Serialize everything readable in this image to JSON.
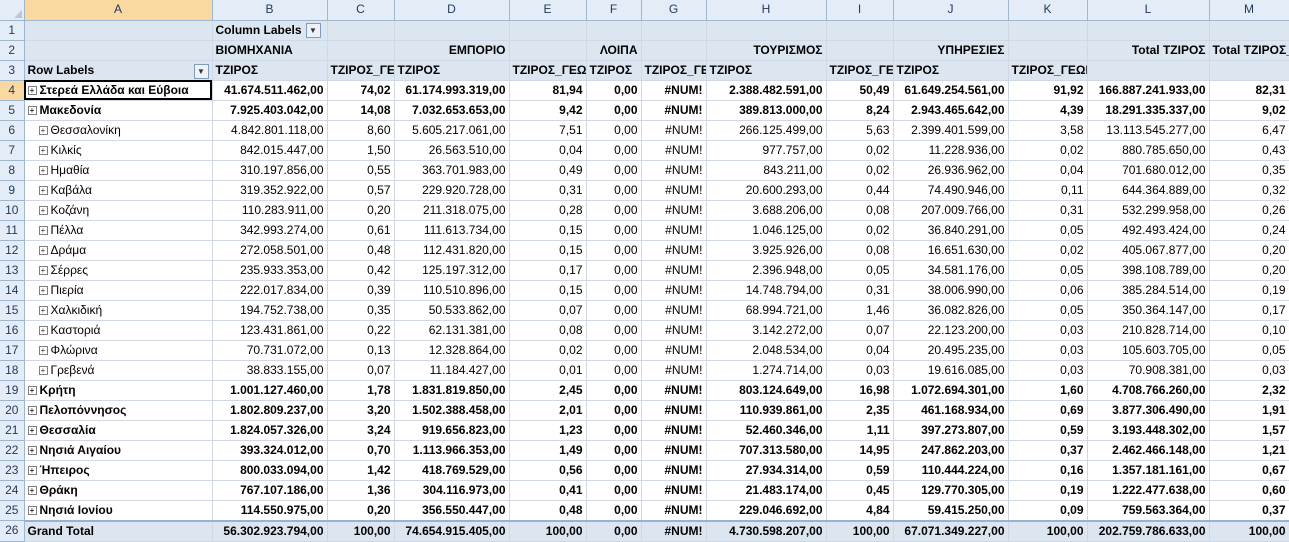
{
  "columns": [
    "A",
    "B",
    "C",
    "D",
    "E",
    "F",
    "G",
    "H",
    "I",
    "J",
    "K",
    "L",
    "M"
  ],
  "rows_numbers": [
    "1",
    "2",
    "3",
    "4",
    "5",
    "6",
    "7",
    "8",
    "9",
    "10",
    "11",
    "12",
    "13",
    "14",
    "15",
    "16",
    "17",
    "18",
    "19",
    "20",
    "21",
    "22",
    "23",
    "24",
    "25",
    "26"
  ],
  "pivot": {
    "column_labels": "Column Labels",
    "row_labels": "Row Labels",
    "categories": {
      "industry": "ΒΙΟΜΗΧΑΝΙΑ",
      "commerce": "ΕΜΠΟΡΙΟ",
      "other": "ΛΟΙΠΑ",
      "tourism": "ΤΟΥΡΙΣΜΟΣ",
      "services": "ΥΠΗΡΕΣΙΕΣ",
      "total_tziros": "Total ΤΖΙΡΟΣ",
      "total_tziros_geo": "Total ΤΖΙΡΟΣ_"
    },
    "subheaders": {
      "b": "ΤΖΙΡΟΣ",
      "c": "ΤΖΙΡΟΣ_ΓΕ",
      "d": "ΤΖΙΡΟΣ",
      "e": "ΤΖΙΡΟΣ_ΓΕΩ",
      "f": "ΤΖΙΡΟΣ",
      "g": "ΤΖΙΡΟΣ_ΓΕΩ",
      "h": "ΤΖΙΡΟΣ",
      "i": "ΤΖΙΡΟΣ_ΓΕ",
      "j": "ΤΖΙΡΟΣ",
      "k": "ΤΖΙΡΟΣ_ΓΕΩΓΡΑΦΙΑ",
      "l": "",
      "m": ""
    },
    "data_rows": [
      {
        "label": "Στερεά Ελλάδα και Εύβοια",
        "level": 0,
        "cells": [
          "41.674.511.462,00",
          "74,02",
          "61.174.993.319,00",
          "81,94",
          "0,00",
          "#NUM!",
          "2.388.482.591,00",
          "50,49",
          "61.649.254.561,00",
          "91,92",
          "166.887.241.933,00",
          "82,31"
        ]
      },
      {
        "label": "Μακεδονία",
        "level": 0,
        "cells": [
          "7.925.403.042,00",
          "14,08",
          "7.032.653.653,00",
          "9,42",
          "0,00",
          "#NUM!",
          "389.813.000,00",
          "8,24",
          "2.943.465.642,00",
          "4,39",
          "18.291.335.337,00",
          "9,02"
        ]
      },
      {
        "label": "Θεσσαλονίκη",
        "level": 1,
        "cells": [
          "4.842.801.118,00",
          "8,60",
          "5.605.217.061,00",
          "7,51",
          "0,00",
          "#NUM!",
          "266.125.499,00",
          "5,63",
          "2.399.401.599,00",
          "3,58",
          "13.113.545.277,00",
          "6,47"
        ]
      },
      {
        "label": "Κιλκίς",
        "level": 1,
        "cells": [
          "842.015.447,00",
          "1,50",
          "26.563.510,00",
          "0,04",
          "0,00",
          "#NUM!",
          "977.757,00",
          "0,02",
          "11.228.936,00",
          "0,02",
          "880.785.650,00",
          "0,43"
        ]
      },
      {
        "label": "Ημαθία",
        "level": 1,
        "cells": [
          "310.197.856,00",
          "0,55",
          "363.701.983,00",
          "0,49",
          "0,00",
          "#NUM!",
          "843.211,00",
          "0,02",
          "26.936.962,00",
          "0,04",
          "701.680.012,00",
          "0,35"
        ]
      },
      {
        "label": "Καβάλα",
        "level": 1,
        "cells": [
          "319.352.922,00",
          "0,57",
          "229.920.728,00",
          "0,31",
          "0,00",
          "#NUM!",
          "20.600.293,00",
          "0,44",
          "74.490.946,00",
          "0,11",
          "644.364.889,00",
          "0,32"
        ]
      },
      {
        "label": "Κοζάνη",
        "level": 1,
        "cells": [
          "110.283.911,00",
          "0,20",
          "211.318.075,00",
          "0,28",
          "0,00",
          "#NUM!",
          "3.688.206,00",
          "0,08",
          "207.009.766,00",
          "0,31",
          "532.299.958,00",
          "0,26"
        ]
      },
      {
        "label": "Πέλλα",
        "level": 1,
        "cells": [
          "342.993.274,00",
          "0,61",
          "111.613.734,00",
          "0,15",
          "0,00",
          "#NUM!",
          "1.046.125,00",
          "0,02",
          "36.840.291,00",
          "0,05",
          "492.493.424,00",
          "0,24"
        ]
      },
      {
        "label": "Δράμα",
        "level": 1,
        "cells": [
          "272.058.501,00",
          "0,48",
          "112.431.820,00",
          "0,15",
          "0,00",
          "#NUM!",
          "3.925.926,00",
          "0,08",
          "16.651.630,00",
          "0,02",
          "405.067.877,00",
          "0,20"
        ]
      },
      {
        "label": "Σέρρες",
        "level": 1,
        "cells": [
          "235.933.353,00",
          "0,42",
          "125.197.312,00",
          "0,17",
          "0,00",
          "#NUM!",
          "2.396.948,00",
          "0,05",
          "34.581.176,00",
          "0,05",
          "398.108.789,00",
          "0,20"
        ]
      },
      {
        "label": "Πιερία",
        "level": 1,
        "cells": [
          "222.017.834,00",
          "0,39",
          "110.510.896,00",
          "0,15",
          "0,00",
          "#NUM!",
          "14.748.794,00",
          "0,31",
          "38.006.990,00",
          "0,06",
          "385.284.514,00",
          "0,19"
        ]
      },
      {
        "label": "Χαλκιδική",
        "level": 1,
        "cells": [
          "194.752.738,00",
          "0,35",
          "50.533.862,00",
          "0,07",
          "0,00",
          "#NUM!",
          "68.994.721,00",
          "1,46",
          "36.082.826,00",
          "0,05",
          "350.364.147,00",
          "0,17"
        ]
      },
      {
        "label": "Καστοριά",
        "level": 1,
        "cells": [
          "123.431.861,00",
          "0,22",
          "62.131.381,00",
          "0,08",
          "0,00",
          "#NUM!",
          "3.142.272,00",
          "0,07",
          "22.123.200,00",
          "0,03",
          "210.828.714,00",
          "0,10"
        ]
      },
      {
        "label": "Φλώρινα",
        "level": 1,
        "cells": [
          "70.731.072,00",
          "0,13",
          "12.328.864,00",
          "0,02",
          "0,00",
          "#NUM!",
          "2.048.534,00",
          "0,04",
          "20.495.235,00",
          "0,03",
          "105.603.705,00",
          "0,05"
        ]
      },
      {
        "label": "Γρεβενά",
        "level": 1,
        "cells": [
          "38.833.155,00",
          "0,07",
          "11.184.427,00",
          "0,01",
          "0,00",
          "#NUM!",
          "1.274.714,00",
          "0,03",
          "19.616.085,00",
          "0,03",
          "70.908.381,00",
          "0,03"
        ]
      },
      {
        "label": "Κρήτη",
        "level": 0,
        "cells": [
          "1.001.127.460,00",
          "1,78",
          "1.831.819.850,00",
          "2,45",
          "0,00",
          "#NUM!",
          "803.124.649,00",
          "16,98",
          "1.072.694.301,00",
          "1,60",
          "4.708.766.260,00",
          "2,32"
        ]
      },
      {
        "label": "Πελοπόννησος",
        "level": 0,
        "cells": [
          "1.802.809.237,00",
          "3,20",
          "1.502.388.458,00",
          "2,01",
          "0,00",
          "#NUM!",
          "110.939.861,00",
          "2,35",
          "461.168.934,00",
          "0,69",
          "3.877.306.490,00",
          "1,91"
        ]
      },
      {
        "label": "Θεσσαλία",
        "level": 0,
        "cells": [
          "1.824.057.326,00",
          "3,24",
          "919.656.823,00",
          "1,23",
          "0,00",
          "#NUM!",
          "52.460.346,00",
          "1,11",
          "397.273.807,00",
          "0,59",
          "3.193.448.302,00",
          "1,57"
        ]
      },
      {
        "label": "Νησιά Αιγαίου",
        "level": 0,
        "cells": [
          "393.324.012,00",
          "0,70",
          "1.113.966.353,00",
          "1,49",
          "0,00",
          "#NUM!",
          "707.313.580,00",
          "14,95",
          "247.862.203,00",
          "0,37",
          "2.462.466.148,00",
          "1,21"
        ]
      },
      {
        "label": "Ήπειρος",
        "level": 0,
        "cells": [
          "800.033.094,00",
          "1,42",
          "418.769.529,00",
          "0,56",
          "0,00",
          "#NUM!",
          "27.934.314,00",
          "0,59",
          "110.444.224,00",
          "0,16",
          "1.357.181.161,00",
          "0,67"
        ]
      },
      {
        "label": "Θράκη",
        "level": 0,
        "cells": [
          "767.107.186,00",
          "1,36",
          "304.116.973,00",
          "0,41",
          "0,00",
          "#NUM!",
          "21.483.174,00",
          "0,45",
          "129.770.305,00",
          "0,19",
          "1.222.477.638,00",
          "0,60"
        ]
      },
      {
        "label": "Νησιά Ιονίου",
        "level": 0,
        "cells": [
          "114.550.975,00",
          "0,20",
          "356.550.447,00",
          "0,48",
          "0,00",
          "#NUM!",
          "229.046.692,00",
          "4,84",
          "59.415.250,00",
          "0,09",
          "759.563.364,00",
          "0,37"
        ]
      }
    ],
    "grand_total": {
      "label": "Grand Total",
      "cells": [
        "56.302.923.794,00",
        "100,00",
        "74.654.915.405,00",
        "100,00",
        "0,00",
        "#NUM!",
        "4.730.598.207,00",
        "100,00",
        "67.071.349.227,00",
        "100,00",
        "202.759.786.633,00",
        "100,00"
      ]
    },
    "expand_glyph": "+",
    "dropdown_glyph": "▼"
  }
}
